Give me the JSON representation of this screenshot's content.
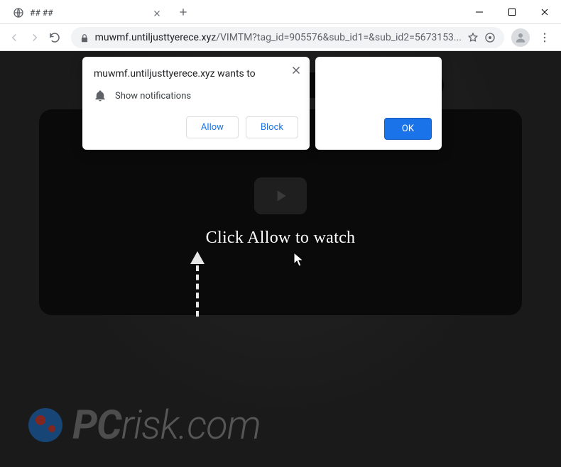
{
  "window": {
    "tab_title": "## ##"
  },
  "toolbar": {
    "url_host": "muwmf.untiljusttyerece.xyz",
    "url_path": "/VIMTM?tag_id=905576&sub_id1=&sub_id2=5673153..."
  },
  "permission_dialog": {
    "title": "muwmf.untiljusttyerece.xyz wants to",
    "request_label": "Show notifications",
    "allow_label": "Allow",
    "block_label": "Block"
  },
  "confirm_dialog": {
    "ok_label": "OK"
  },
  "page": {
    "cta_text": "Click Allow to watch"
  },
  "watermark": {
    "brand_prefix": "PC",
    "brand_rest": "risk.com"
  },
  "icons": {
    "globe": "globe-icon",
    "close": "close-icon",
    "plus": "plus-icon",
    "minimize": "minimize-icon",
    "maximize": "maximize-icon",
    "win_close": "window-close-icon",
    "back": "back-icon",
    "forward": "forward-icon",
    "reload": "reload-icon",
    "lock": "lock-icon",
    "star": "star-icon",
    "avatar": "avatar-icon",
    "menu": "menu-icon",
    "bell": "bell-icon",
    "play": "play-icon",
    "cursor": "cursor-icon",
    "badge": "badge-icon"
  }
}
